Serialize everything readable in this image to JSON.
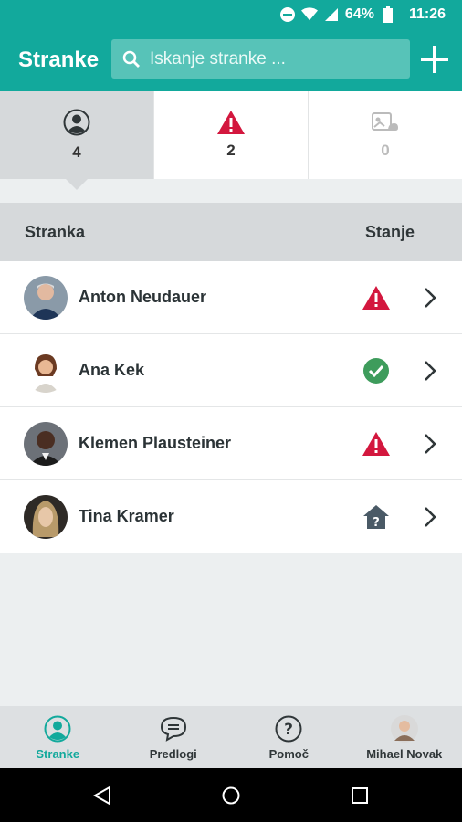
{
  "status_bar": {
    "battery": "64%",
    "time": "11:26"
  },
  "app_bar": {
    "title": "Stranke",
    "search_placeholder": "Iskanje stranke ..."
  },
  "filters": [
    {
      "icon": "person-circle-icon",
      "count": "4"
    },
    {
      "icon": "warning-icon",
      "count": "2"
    },
    {
      "icon": "no-signal-icon",
      "count": "0"
    }
  ],
  "table": {
    "col_client": "Stranka",
    "col_state": "Stanje",
    "rows": [
      {
        "name": "Anton Neudauer",
        "state": "warning"
      },
      {
        "name": "Ana Kek",
        "state": "ok"
      },
      {
        "name": "Klemen Plausteiner",
        "state": "warning"
      },
      {
        "name": "Tina Kramer",
        "state": "home-alert"
      }
    ]
  },
  "bottom_nav": [
    {
      "label": "Stranke",
      "icon": "person-circle-icon"
    },
    {
      "label": "Predlogi",
      "icon": "chat-bubble-icon"
    },
    {
      "label": "Pomoč",
      "icon": "help-icon"
    },
    {
      "label": "Mihael Novak",
      "icon": "avatar"
    }
  ],
  "colors": {
    "primary": "#12a99c",
    "warning": "#d3173e",
    "ok": "#3e9c5c",
    "home": "#4a5a66"
  }
}
